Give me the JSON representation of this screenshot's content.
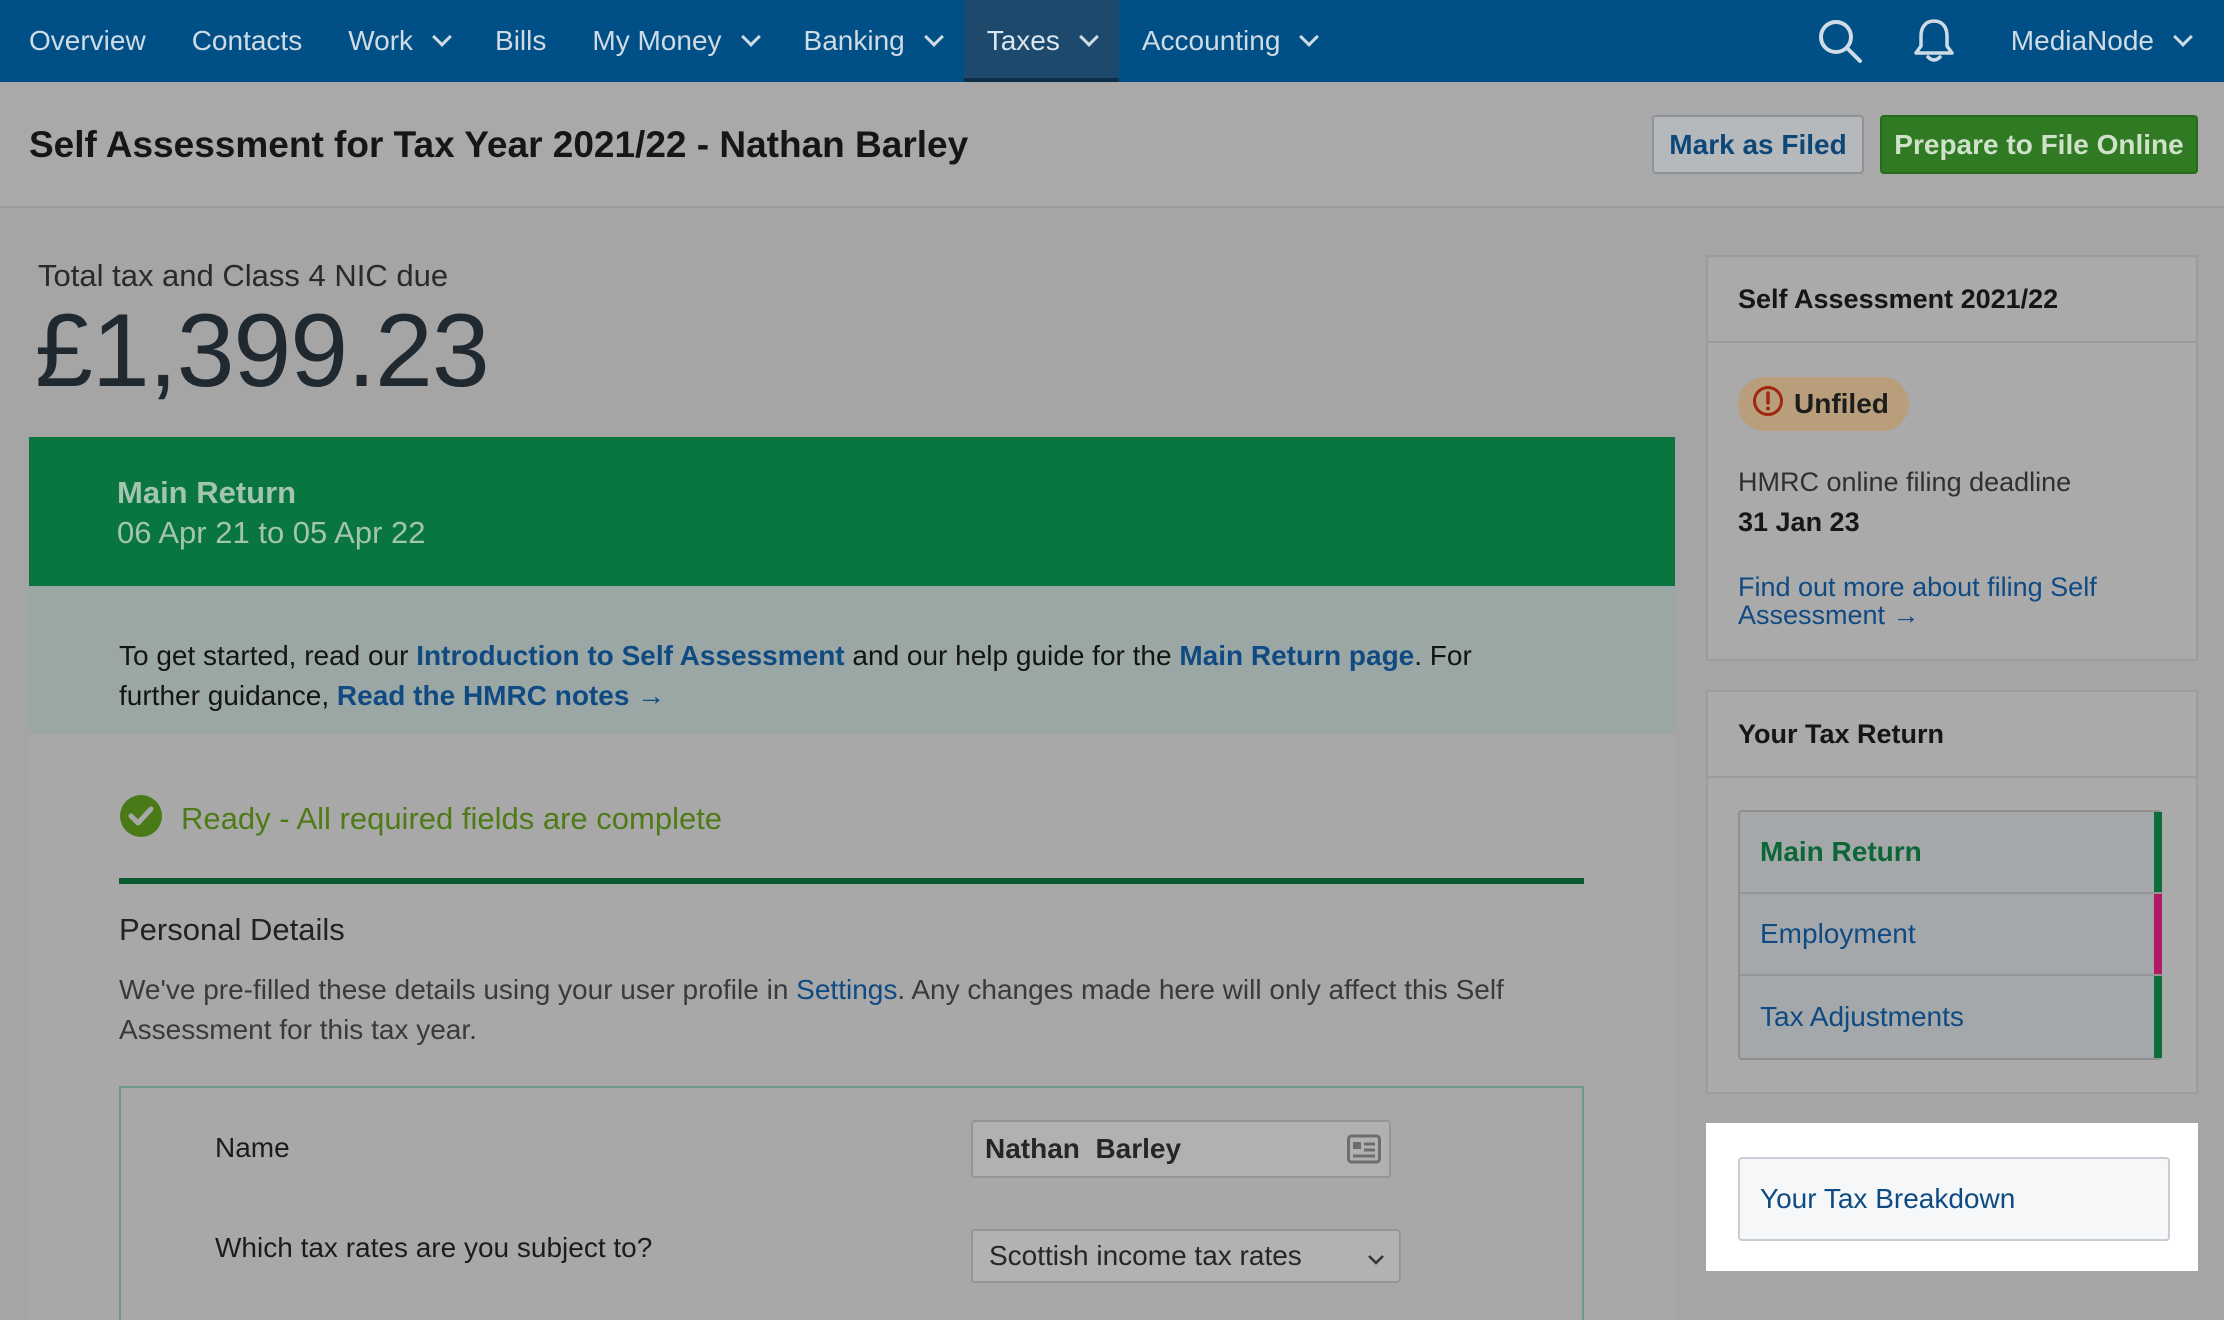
{
  "nav": {
    "items": [
      {
        "label": "Overview",
        "dropdown": false
      },
      {
        "label": "Contacts",
        "dropdown": false
      },
      {
        "label": "Work",
        "dropdown": true
      },
      {
        "label": "Bills",
        "dropdown": false
      },
      {
        "label": "My Money",
        "dropdown": true
      },
      {
        "label": "Banking",
        "dropdown": true
      },
      {
        "label": "Taxes",
        "dropdown": true,
        "active": true
      },
      {
        "label": "Accounting",
        "dropdown": true
      }
    ],
    "icons": [
      "search-icon",
      "bell-icon"
    ],
    "user": "MediaNode"
  },
  "header": {
    "title": "Self Assessment for Tax Year 2021/22 - Nathan Barley",
    "mark_filed_label": "Mark as Filed",
    "prepare_label": "Prepare to File Online"
  },
  "summary": {
    "total_label": "Total tax and Class 4 NIC due",
    "total_amount": "£1,399.23"
  },
  "banner": {
    "title": "Main Return",
    "dates": "06 Apr 21 to 05 Apr 22"
  },
  "info": {
    "t1": "To get started, read our ",
    "link1": "Introduction to Self Assessment",
    "t2": " and our help guide for the ",
    "link2": "Main Return page",
    "t3": ". For further guidance, ",
    "link3": "Read the HMRC notes →"
  },
  "status": {
    "ready_text": "Ready - All required fields are complete"
  },
  "personal": {
    "title": "Personal Details",
    "desc1": "We've pre-filled these details using your user profile in ",
    "settings_link": "Settings",
    "desc2": ". Any changes made here will only affect this Self Assessment for this tax year.",
    "name_label": "Name",
    "name_value": "Nathan  Barley",
    "rates_label": "Which tax rates are you subject to?",
    "rates_value": "Scottish income tax rates"
  },
  "sidebar": {
    "sa_card": {
      "title": "Self Assessment 2021/22",
      "badge": "Unfiled",
      "deadline_label": "HMRC online filing deadline",
      "deadline_value": "31 Jan 23",
      "link": "Find out more about filing Self Assessment →"
    },
    "return_card": {
      "title": "Your Tax Return",
      "items": [
        {
          "label": "Main Return",
          "bar_color": "#0b6e3a"
        },
        {
          "label": "Employment",
          "bar_color": "#b01a64"
        },
        {
          "label": "Tax Adjustments",
          "bar_color": "#0b6e3a"
        }
      ]
    },
    "breakdown_label": "Your Tax Breakdown"
  },
  "colors": {
    "nav_bg": "#005087",
    "banner_green": "#08763e",
    "primary_button": "#2f7a22",
    "link_blue": "#0f4a82",
    "ready_green": "#4e7a17"
  }
}
